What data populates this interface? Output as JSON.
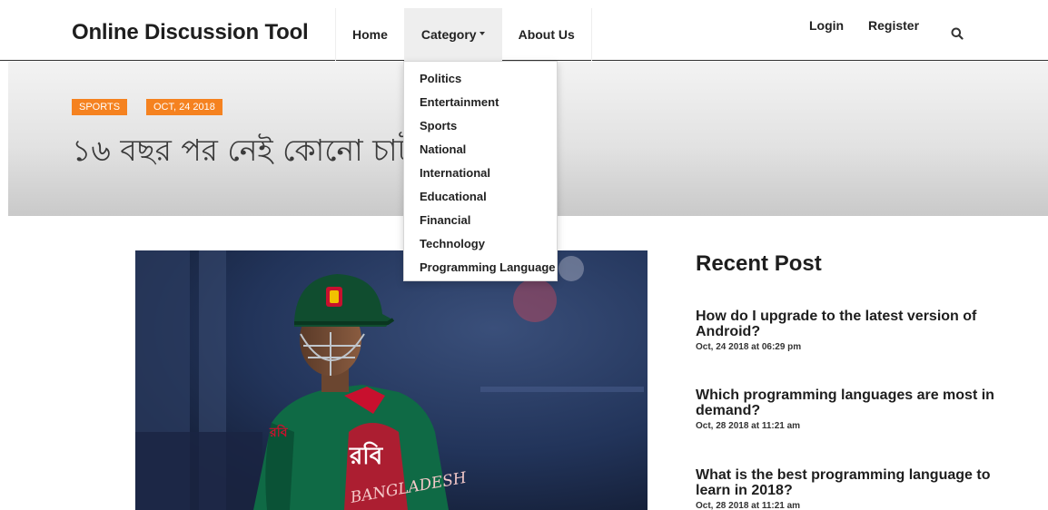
{
  "navbar": {
    "brand": "Online Discussion Tool",
    "items": [
      {
        "label": "Home"
      },
      {
        "label": "Category"
      },
      {
        "label": "About Us"
      }
    ],
    "login_label": "Login",
    "register_label": "Register",
    "search_icon": "search-icon"
  },
  "dropdown": {
    "items": [
      "Politics",
      "Entertainment",
      "Sports",
      "National",
      "International",
      "Educational",
      "Financial",
      "Technology",
      "Programming Language"
    ]
  },
  "hero": {
    "category_badge": "SPORTS",
    "date_badge": "OCT, 24 2018",
    "title": "১৬ বছর পর নেই কোনো চাট"
  },
  "sidebar": {
    "heading": "Recent Post",
    "posts": [
      {
        "title": "How do I upgrade to the latest version of Android?",
        "date": "Oct, 24 2018 at 06:29 pm"
      },
      {
        "title": "Which programming languages are most in demand?",
        "date": "Oct, 28 2018 at 11:21 am"
      },
      {
        "title": "What is the best programming language to learn in 2018?",
        "date": "Oct, 28 2018 at 11:21 am"
      }
    ]
  },
  "colors": {
    "badge": "#f58220",
    "text": "#1e1e1e",
    "active_nav": "#eeeeee"
  },
  "jersey_text": {
    "logo": "রবি",
    "country": "BANGLADESH"
  }
}
